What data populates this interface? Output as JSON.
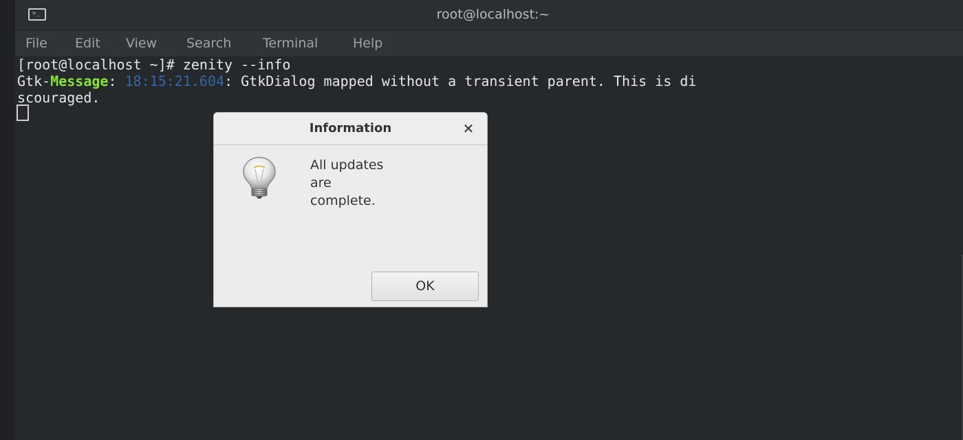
{
  "window": {
    "title": "root@localhost:~",
    "icon": "terminal-icon",
    "icon_glyph": ">_"
  },
  "menubar": {
    "items": [
      "File",
      "Edit",
      "View",
      "Search",
      "Terminal",
      "Help"
    ]
  },
  "terminal": {
    "lines": {
      "command": "[root@localhost ~]# zenity --info",
      "message_prefix": "Gtk-",
      "message_keyword": "Message",
      "message_colon": ": ",
      "message_time": "18:15:21.604",
      "message_text": ": GtkDialog mapped without a transient parent. This is di",
      "message_wrap": "scouraged."
    }
  },
  "dialog": {
    "title": "Information",
    "close_label": "✕",
    "icon": "lightbulb-icon",
    "message_lines": [
      "All updates",
      "are",
      "complete."
    ],
    "ok_label": "OK"
  },
  "colors": {
    "terminal_bg": "#25292b",
    "message_keyword": "#8ae234",
    "message_time": "#3465a4",
    "dialog_bg": "#ececec"
  }
}
